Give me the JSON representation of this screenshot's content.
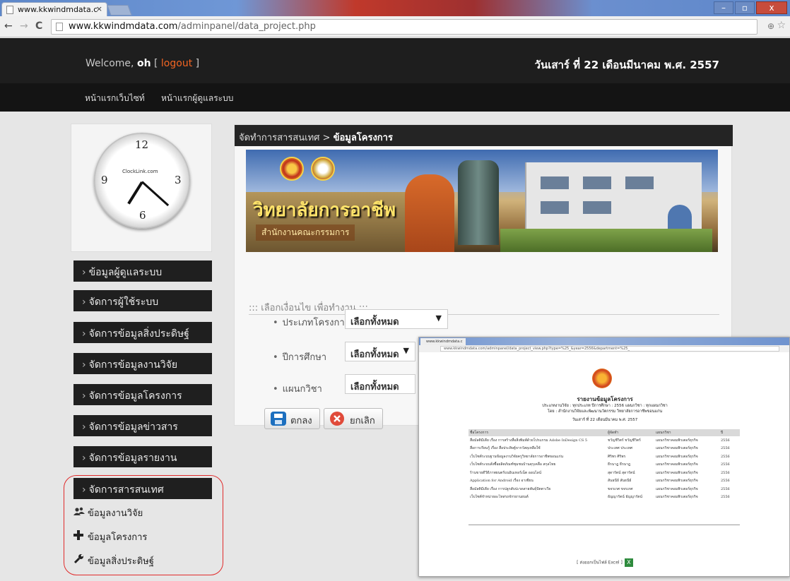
{
  "browser": {
    "tab_title": "www.kkwindmdata.c",
    "url_domain": "www.kkwindmdata.com",
    "url_path": "/adminpanel/data_project.php",
    "tab_close_glyph": "×",
    "back_glyph": "←",
    "forward_glyph": "→",
    "reload_glyph": "C",
    "zoom_glyph": "⊕",
    "star_glyph": "☆",
    "minimize_glyph": "–",
    "maximize_glyph": "▫",
    "close_glyph": "x"
  },
  "header": {
    "welcome_prefix": "Welcome, ",
    "username": "oh",
    "logout_open": " [ ",
    "logout_label": "logout",
    "logout_close": " ]",
    "date": "วันเสาร์ ที่ 22 เดือนมีนาคม พ.ศ. 2557"
  },
  "menu": {
    "home_site": "หน้าแรกเว็บไซท์",
    "home_admin": "หน้าแรกผู้ดูแลระบบ"
  },
  "clock": {
    "n12": "12",
    "n3": "3",
    "n6": "6",
    "n9": "9",
    "brand": "ClockLink.com"
  },
  "sidebar": {
    "chevron": "›",
    "items": [
      {
        "label": "ข้อมูลผู้ดูแลระบบ"
      },
      {
        "label": "จัดการผู้ใช้ระบบ"
      },
      {
        "label": "จัดการข้อมูลสิ่งประดิษฐ์"
      },
      {
        "label": "จัดการข้อมูลงานวิจัย"
      },
      {
        "label": "จัดการข้อมูลโครงการ"
      },
      {
        "label": "จัดการข้อมูลข่าวสาร"
      },
      {
        "label": "จัดการข้อมูลรายงาน"
      },
      {
        "label": "จัดการสารสนเทศ"
      }
    ],
    "sub_items": [
      {
        "label": "ข้อมูลงานวิจัย",
        "icon": "users-icon"
      },
      {
        "label": "ข้อมูลโครงการ",
        "icon": "plus-icon"
      },
      {
        "label": "ข้อมูลสิ่งประดิษฐ์",
        "icon": "wrench-icon"
      }
    ]
  },
  "main": {
    "breadcrumb_parent": "จัดทำการสารสนเทศ",
    "breadcrumb_sep": " > ",
    "breadcrumb_current": "ข้อมูลโครงการ",
    "banner_title": "วิทยาลัยการอาชีพ",
    "banner_subtitle": "สำนักงานคณะกรรมการ",
    "form_heading": "::: เลือกเงื่อนไข เพื่อทำงาน :::",
    "bullet": "•",
    "fields": [
      {
        "label": "ประเภทโครงการ",
        "value": "เลือกทั้งหมด"
      },
      {
        "label": "ปีการศึกษา",
        "value": "เลือกทั้งหมด"
      },
      {
        "label": "แผนกวิชา",
        "value": "เลือกทั้งหมด"
      }
    ],
    "caret": "▼",
    "submit_label": "ตกลง",
    "cancel_label": "ยกเลิก"
  },
  "report": {
    "tab_title": "www.kkwindmdata.c",
    "url": "www.kkwindmdata.com/adminpanel/data_project_view.php?type=%25_&year=2556&department=%25_",
    "title": "รายงานข้อมูลโครงการ",
    "filter_line": "ประเภทงานวิจัย : ทุกประเภท   ปีการศึกษา : 2556   แผนกวิชา : ทุกแผนกวิชา",
    "org_line": "โดย : สำนักงานวิจัยและพัฒนานวัตกรรม วิทยาลัยการอาชีพขอนแก่น",
    "date_line": "วันเสาร์ ที่ 22 เดือนมีนาคม พ.ศ. 2557",
    "columns": [
      "ชื่อโครงการ",
      "ผู้จัดทำ",
      "แผนกวิชา",
      "ปี"
    ],
    "rows": [
      [
        "สื่อมัลติมีเดีย เรื่อง การสร้างสื่อสิ่งพิมพ์ด้วยโปรแกรม Adobe InDesign CS 5",
        "ชวัญชีวิตร์ ชวัญชีวิตร์",
        "แผนกวิชาคอมพิวเตอร์ธุรกิจ",
        "2556"
      ],
      [
        "สื่อการเรียนรู้ เรื่อง สื่อประดิษฐ์จากวัสดุเหลือใช้",
        "ประเทศ ประเทศ",
        "แผนกวิชาคอมพิวเตอร์ธุรกิจ",
        "2556"
      ],
      [
        "เว็บไซต์ระบบฐานข้อมูลงานวิจัยครูวิทยาลัยการอาชีพขอนแก่น",
        "ศิริพร ศิริพร",
        "แผนกวิชาคอมพิวเตอร์ธุรกิจ",
        "2556"
      ],
      [
        "เว็บไซต์ระบบสั่งซื้อผลิตภัณฑ์ชุมชนบ้านคุรุเคลื่อ สกุลไทย",
        "ธีรนาฎ ธีรนาฎ",
        "แผนกวิชาคอมพิวเตอร์ธุรกิจ",
        "2556"
      ],
      [
        "ร้านขายดีวีดีภาพยนตร์บนอินเทอร์เน็ต ออนไลน์",
        "สุดารัตน์ สุดารัตน์",
        "แผนกวิชาคอมพิวเตอร์ธุรกิจ",
        "2556"
      ],
      [
        "Application for Android เรื่อง อาเซียน",
        "สันธนีย์ สันธนีย์",
        "แผนกวิชาคอมพิวเตอร์ธุรกิจ",
        "2556"
      ],
      [
        "สื่อมัลติมีเดีย เรื่อง การปลูกสับปะรดสายพันธุ์ปัตตาเวีย",
        "ขจรเกศ ขจรเกศ",
        "แผนกวิชาคอมพิวเตอร์ธุรกิจ",
        "2556"
      ],
      [
        "เว็บไซต์จำหน่ายอะไหล่รถจักรยานยนต์",
        "ธัญญารัตน์ ธัญญารัตน์",
        "แผนกวิชาคอมพิวเตอร์ธุรกิจ",
        "2556"
      ]
    ],
    "export_label": "[ ส่งออกเป็นไฟล์ Excel ]",
    "excel_glyph": "X"
  },
  "colors": {
    "accent_logout": "#f26522",
    "header_bg": "#1e1e1e",
    "sidebar_bg": "#1f1f1f",
    "highlight_ring": "#e02b2b"
  }
}
